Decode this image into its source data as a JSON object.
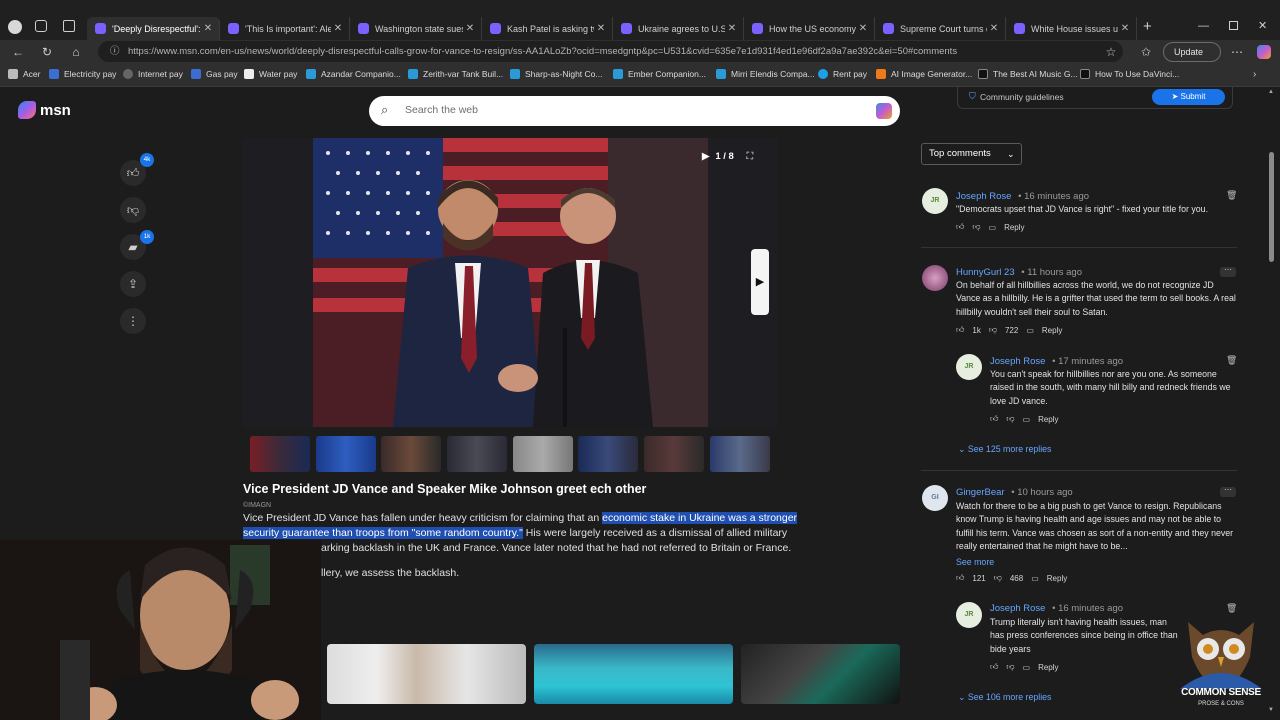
{
  "browser": {
    "tabs": [
      {
        "title": "'Deeply Disrespectful': Ca",
        "active": true,
        "color": "#7b61ff"
      },
      {
        "title": "'This Is important': Alexan",
        "active": false,
        "color": "#7b61ff"
      },
      {
        "title": "Washington state sues ru",
        "active": false,
        "color": "#7b61ff"
      },
      {
        "title": "Kash Patel is asking two c",
        "active": false,
        "color": "#7b61ff"
      },
      {
        "title": "Ukraine agrees to U.S.-le",
        "active": false,
        "color": "#7b61ff"
      },
      {
        "title": "How the US economy wo",
        "active": false,
        "color": "#7b61ff"
      },
      {
        "title": "Supreme Court turns do",
        "active": false,
        "color": "#7b61ff"
      },
      {
        "title": "White House issues unhi",
        "active": false,
        "color": "#7b61ff"
      }
    ],
    "url": "https://www.msn.com/en-us/news/world/deeply-disrespectful-calls-grow-for-vance-to-resign/ss-AA1ALoZb?ocid=msedgntp&pc=U531&cvid=635e7e1d931f4ed1e96df2a9a7ae392c&ei=50#comments",
    "update_label": "Update",
    "bookmarks": [
      {
        "label": "Acer",
        "color": "#444"
      },
      {
        "label": "Electricity pay",
        "color": "#3c6ed1"
      },
      {
        "label": "Internet pay",
        "color": "#555"
      },
      {
        "label": "Gas pay",
        "color": "#3c6ed1"
      },
      {
        "label": "Water pay",
        "color": "#eee"
      },
      {
        "label": "Azandar Companio...",
        "color": "#2a9bd6"
      },
      {
        "label": "Zerith-var Tank Buil...",
        "color": "#2a9bd6"
      },
      {
        "label": "Sharp-as-Night Co...",
        "color": "#2a9bd6"
      },
      {
        "label": "Ember Companion...",
        "color": "#2a9bd6"
      },
      {
        "label": "Mirri Elendis Compa...",
        "color": "#2a9bd6"
      },
      {
        "label": "Rent pay",
        "color": "#1ea0e8"
      },
      {
        "label": "AI Image Generator...",
        "color": "#f07a1a"
      },
      {
        "label": "The Best AI Music G...",
        "color": "#222"
      },
      {
        "label": "How To Use DaVinci...",
        "color": "#222"
      }
    ]
  },
  "site": {
    "logo": "msn",
    "search_placeholder": "Search the web"
  },
  "rail": {
    "like_count": "4k",
    "comment_count": "1k"
  },
  "gallery": {
    "counter": "1 / 8",
    "caption": "Vice President JD Vance and Speaker Mike Johnson greet ech other",
    "credit": "©IMAGN",
    "body_line1_pre": "Vice President JD Vance has fallen under heavy criticism for claiming that an ",
    "body_line1_hl": "economic stake in Ukraine was a stronger",
    "body_line2_hl": "security guarantee than troops from \"some random country.\"",
    "body_line2_post": " His were largely received as a dismissal of allied military",
    "body_line3": "arking backlash in the UK and France. Vance later noted that he had not referred to Britain or France.",
    "body_line4": "llery, we assess the backlash."
  },
  "comments_panel": {
    "community_guidelines": "Community guidelines",
    "submit_label": "Submit",
    "sort_label": "Top comments",
    "comments": [
      {
        "initials": "JR",
        "name": "Joseph Rose",
        "time": "16 minutes ago",
        "text": "\"Democrats upset that JD Vance is right\" - fixed your title for you.",
        "likes": "",
        "dislikes": "",
        "reply": "Reply"
      },
      {
        "initials": "",
        "name": "HunnyGurl 23",
        "time": "11 hours ago",
        "text": "On behalf of all hillbillies across the world, we do not recognize JD Vance as a hillbilly. He is a grifter that used the term to sell books. A real hillbilly wouldn't sell their soul to Satan.",
        "likes": "1k",
        "dislikes": "722",
        "reply": "Reply"
      },
      {
        "initials": "JR",
        "name": "Joseph Rose",
        "time": "17 minutes ago",
        "text": "You can't speak for hillbillies nor are you one. As someone raised in the south, with many hill billy and redneck friends we love JD vance.",
        "likes": "",
        "dislikes": "",
        "reply": "Reply"
      },
      {
        "initials": "GI",
        "name": "GingerBear",
        "time": "10 hours ago",
        "text": "Watch for there to be a big push to get Vance to resign. Republicans know Trump is having health and age issues and may not be able to fulfill his term. Vance was chosen as sort of a non-entity and they never really entertained that he might have to be...",
        "likes": "121",
        "dislikes": "468",
        "reply": "Reply"
      },
      {
        "initials": "JR",
        "name": "Joseph Rose",
        "time": "16 minutes ago",
        "text": "Trump literally isn't having health issues, man has press conferences since being in office than bide years",
        "likes": "",
        "dislikes": "",
        "reply": "Reply"
      }
    ],
    "see_more_replies_1": "See 125 more replies",
    "see_more": "See more",
    "see_more_replies_2": "See 106 more replies"
  },
  "overlay": {
    "brand_line1": "COMMON SENSE",
    "brand_line2": "PROSE & CONS"
  },
  "colors": {
    "accent": "#1a73e8",
    "link": "#66a6ff",
    "highlight": "#1f4fb0"
  }
}
